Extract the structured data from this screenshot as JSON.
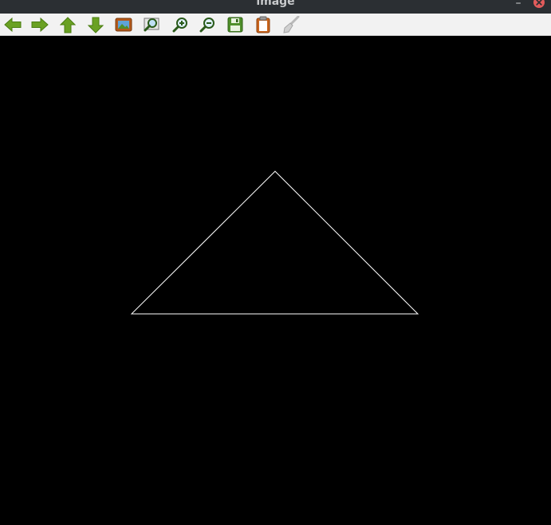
{
  "window": {
    "title": "image",
    "minimize_glyph": "–",
    "close_icon": "close-icon"
  },
  "toolbar": {
    "tools": [
      {
        "name": "back-arrow-icon"
      },
      {
        "name": "forward-arrow-icon"
      },
      {
        "name": "up-arrow-icon"
      },
      {
        "name": "down-arrow-icon"
      },
      {
        "name": "picture-icon"
      },
      {
        "name": "zoom-fit-icon"
      },
      {
        "name": "zoom-in-icon"
      },
      {
        "name": "zoom-out-icon"
      },
      {
        "name": "save-icon"
      },
      {
        "name": "clipboard-icon"
      },
      {
        "name": "clear-brush-icon"
      }
    ]
  },
  "colors": {
    "arrow_green": "#6aa123",
    "canvas_background": "#000000",
    "shape_stroke": "#ffffff",
    "close_red": "#e25b5b"
  },
  "canvas": {
    "shape": "triangle"
  }
}
